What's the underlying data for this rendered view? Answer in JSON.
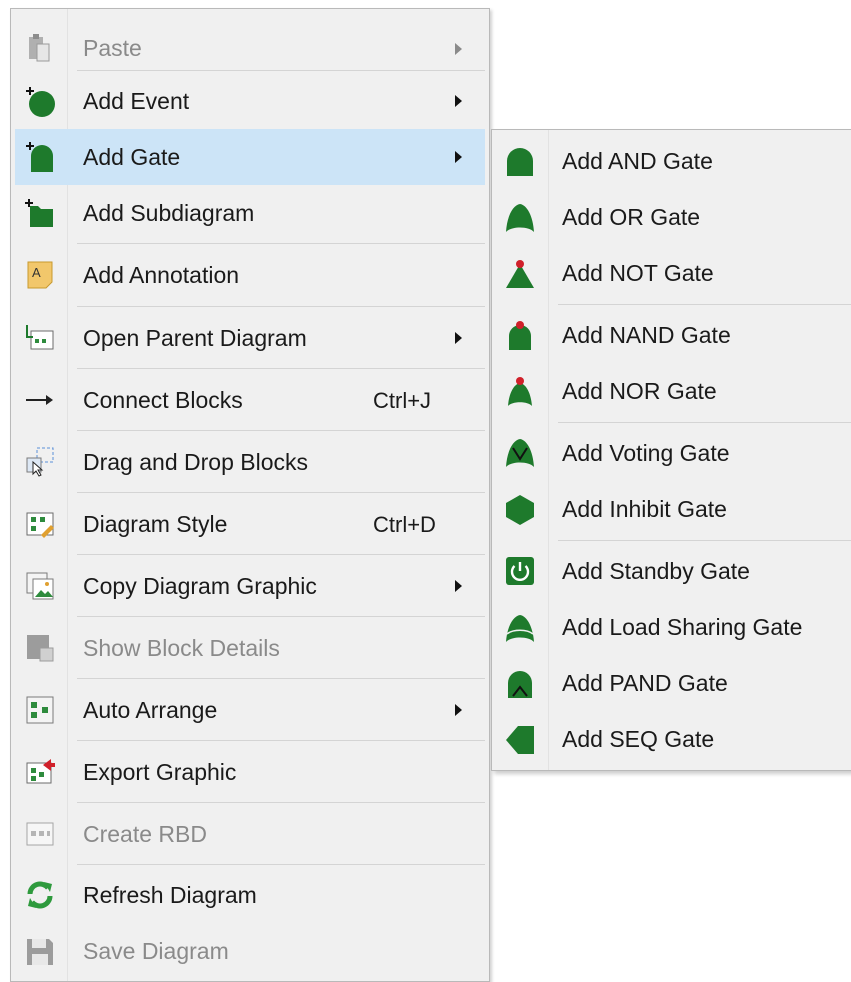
{
  "context_menu": {
    "items": [
      {
        "label": "Paste",
        "icon": "paste-icon",
        "disabled": true,
        "submenu": true
      },
      {
        "label": "Add Event",
        "icon": "add-event-icon",
        "submenu": true
      },
      {
        "label": "Add Gate",
        "icon": "add-gate-icon",
        "submenu": true,
        "highlighted": true
      },
      {
        "label": "Add Subdiagram",
        "icon": "add-subdiagram-icon"
      },
      {
        "label": "Add Annotation",
        "icon": "add-annotation-icon"
      },
      {
        "label": "Open Parent Diagram",
        "icon": "open-parent-diagram-icon",
        "submenu": true
      },
      {
        "label": "Connect Blocks",
        "icon": "connect-arrow-icon",
        "shortcut": "Ctrl+J"
      },
      {
        "label": "Drag and Drop Blocks",
        "icon": "drag-drop-icon"
      },
      {
        "label": "Diagram Style",
        "icon": "diagram-style-icon",
        "shortcut": "Ctrl+D"
      },
      {
        "label": "Copy Diagram Graphic",
        "icon": "copy-graphic-icon",
        "submenu": true
      },
      {
        "label": "Show Block Details",
        "icon": "block-details-icon",
        "disabled": true
      },
      {
        "label": "Auto Arrange",
        "icon": "auto-arrange-icon",
        "submenu": true
      },
      {
        "label": "Export Graphic",
        "icon": "export-graphic-icon"
      },
      {
        "label": "Create RBD",
        "icon": "create-rbd-icon",
        "disabled": true
      },
      {
        "label": "Refresh Diagram",
        "icon": "refresh-icon"
      },
      {
        "label": "Save Diagram",
        "icon": "save-icon",
        "disabled": true
      }
    ]
  },
  "gate_submenu": {
    "items": [
      {
        "label": "Add AND Gate",
        "icon": "and-gate-icon"
      },
      {
        "label": "Add OR Gate",
        "icon": "or-gate-icon"
      },
      {
        "label": "Add NOT Gate",
        "icon": "not-gate-icon"
      },
      {
        "label": "Add NAND Gate",
        "icon": "nand-gate-icon"
      },
      {
        "label": "Add NOR Gate",
        "icon": "nor-gate-icon"
      },
      {
        "label": "Add Voting Gate",
        "icon": "voting-gate-icon"
      },
      {
        "label": "Add Inhibit Gate",
        "icon": "inhibit-gate-icon"
      },
      {
        "label": "Add Standby Gate",
        "icon": "standby-gate-icon"
      },
      {
        "label": "Add Load Sharing Gate",
        "icon": "load-sharing-gate-icon"
      },
      {
        "label": "Add PAND Gate",
        "icon": "pand-gate-icon"
      },
      {
        "label": "Add SEQ Gate",
        "icon": "seq-gate-icon"
      }
    ]
  },
  "colors": {
    "highlight": "#cce4f7",
    "gate_green": "#1e7a2c",
    "gate_red": "#d0202a",
    "disabled_text": "#8a8a8a"
  }
}
